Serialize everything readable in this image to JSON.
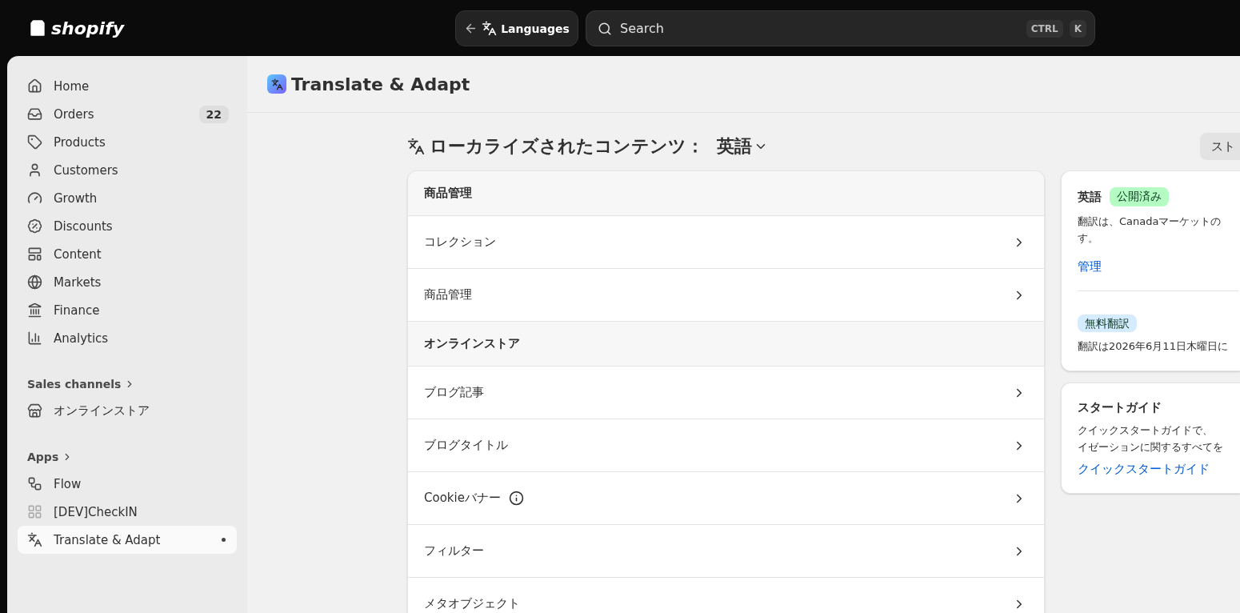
{
  "topbar": {
    "logo": "shopify",
    "back_button": "Languages",
    "search": {
      "placeholder": "Search",
      "shortcut": [
        "CTRL",
        "K"
      ]
    }
  },
  "sidebar": {
    "items": [
      {
        "label": "Home",
        "selected": false
      },
      {
        "label": "Orders",
        "badge": "22",
        "selected": false
      },
      {
        "label": "Products",
        "selected": false
      },
      {
        "label": "Customers",
        "selected": false
      },
      {
        "label": "Growth",
        "selected": false
      },
      {
        "label": "Discounts",
        "selected": false
      },
      {
        "label": "Content",
        "selected": false
      },
      {
        "label": "Markets",
        "selected": false
      },
      {
        "label": "Finance",
        "selected": false
      },
      {
        "label": "Analytics",
        "selected": false
      }
    ],
    "sections": [
      {
        "title": "Sales channels",
        "items": [
          {
            "label": "オンラインストア",
            "selected": false
          }
        ]
      },
      {
        "title": "Apps",
        "items": [
          {
            "label": "Flow",
            "selected": false
          },
          {
            "label": "[DEV]CheckIN",
            "selected": false
          },
          {
            "label": "Translate & Adapt",
            "selected": true
          }
        ]
      }
    ]
  },
  "page": {
    "title": "Translate & Adapt",
    "heading": "ローカライズされたコンテンツ：",
    "language": "英語",
    "store_button": "スト",
    "groups": [
      {
        "title": "商品管理",
        "rows": [
          {
            "label": "コレクション",
            "info": false
          },
          {
            "label": "商品管理",
            "info": false
          }
        ]
      },
      {
        "title": "オンラインストア",
        "rows": [
          {
            "label": "ブログ記事",
            "info": false
          },
          {
            "label": "ブログタイトル",
            "info": false
          },
          {
            "label": "Cookieバナー",
            "info": true
          },
          {
            "label": "フィルター",
            "info": false
          },
          {
            "label": "メタオブジェクト",
            "info": false
          }
        ]
      }
    ],
    "status_card": {
      "language": "英語",
      "status": "公開済み",
      "lines": [
        "翻訳は、Canadaマーケットの",
        "す。"
      ],
      "link": "管理",
      "plan_badge": "無料翻訳",
      "plan_text": "翻訳は2026年6月11日木曜日に"
    },
    "guide_card": {
      "title": "スタートガイド",
      "lines": [
        "クイックスタートガイドで、",
        "イゼーションに関するすべてを"
      ],
      "link": "クイックスタートガイド"
    }
  }
}
